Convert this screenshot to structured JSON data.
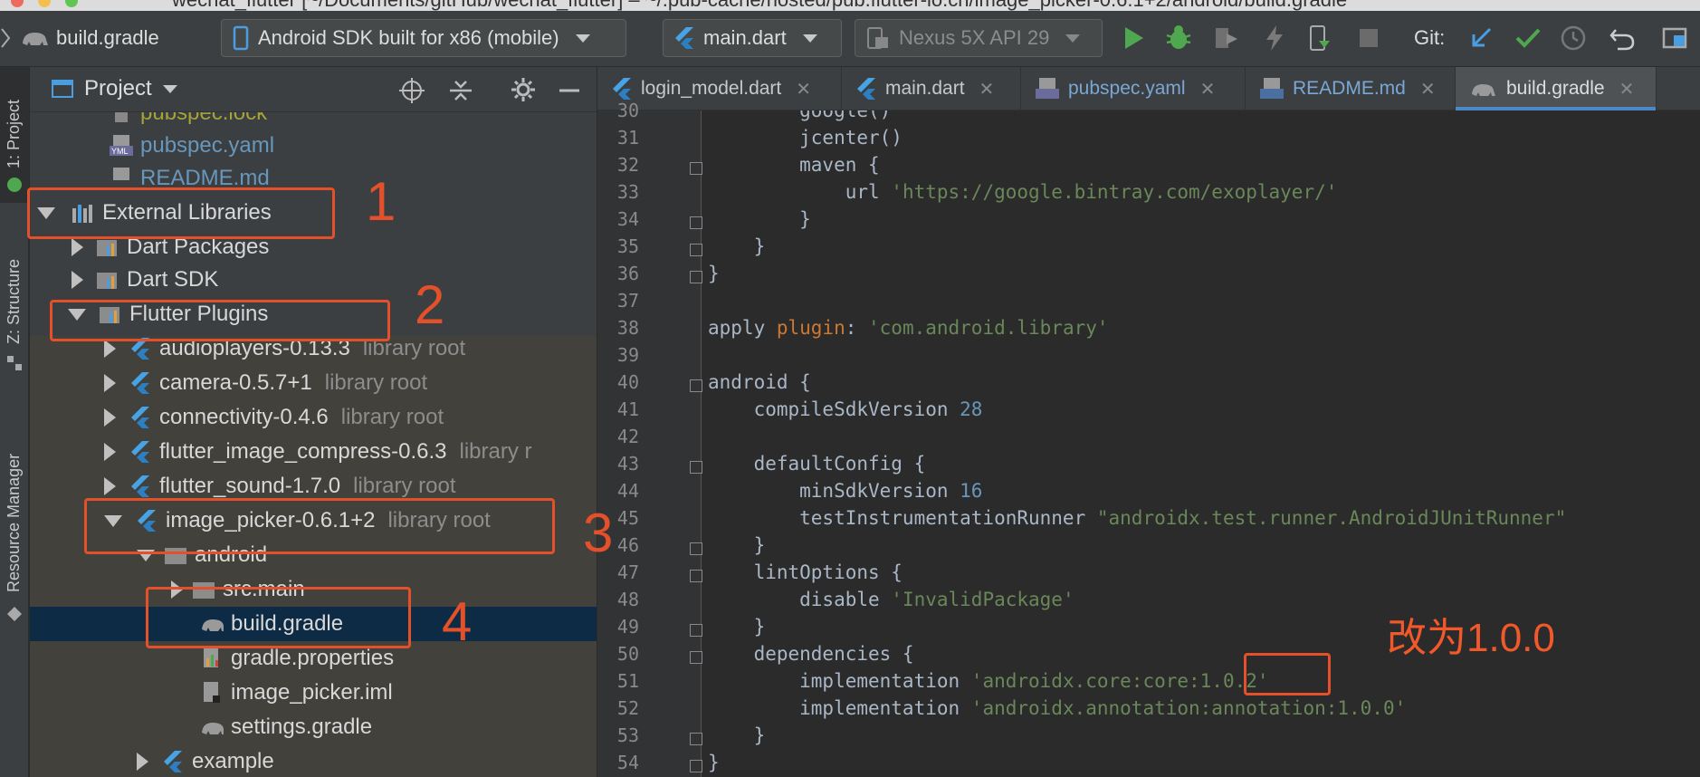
{
  "window": {
    "title_fragment": "wechat_flutter [~/Documents/gitHub/wechat_flutter] – ~/.pub-cache/hosted/pub.flutter-io.cn/image_picker-0.6.1+2/android/build.gradle"
  },
  "toolbar": {
    "breadcrumb_file": "build.gradle",
    "device_combo": "Android SDK built for x86 (mobile)",
    "run_config_combo": "main.dart",
    "emulator_combo": "Nexus 5X API 29",
    "git_label": "Git:"
  },
  "stripe": {
    "project_tab": "1: Project",
    "structure_tab": "Z: Structure",
    "resource_tab": "Resource Manager"
  },
  "project_panel": {
    "title": "Project",
    "rows": [
      {
        "label": "pubspec.lock",
        "extra": ""
      },
      {
        "label": "pubspec.yaml",
        "extra": ""
      },
      {
        "label": "README.md",
        "extra": ""
      },
      {
        "label": "External Libraries",
        "extra": ""
      },
      {
        "label": "Dart Packages",
        "extra": ""
      },
      {
        "label": "Dart SDK",
        "extra": ""
      },
      {
        "label": "Flutter Plugins",
        "extra": ""
      },
      {
        "label": "audioplayers-0.13.3",
        "extra": "library root"
      },
      {
        "label": "camera-0.5.7+1",
        "extra": "library root"
      },
      {
        "label": "connectivity-0.4.6",
        "extra": "library root"
      },
      {
        "label": "flutter_image_compress-0.6.3",
        "extra": "library r"
      },
      {
        "label": "flutter_sound-1.7.0",
        "extra": "library root"
      },
      {
        "label": "image_picker-0.6.1+2",
        "extra": "library root"
      },
      {
        "label": "android",
        "extra": ""
      },
      {
        "label": "src.main",
        "extra": ""
      },
      {
        "label": "build.gradle",
        "extra": ""
      },
      {
        "label": "gradle.properties",
        "extra": ""
      },
      {
        "label": "image_picker.iml",
        "extra": ""
      },
      {
        "label": "settings.gradle",
        "extra": ""
      },
      {
        "label": "example",
        "extra": ""
      }
    ]
  },
  "tabs": [
    {
      "label": "login_model.dart"
    },
    {
      "label": "main.dart"
    },
    {
      "label": "pubspec.yaml"
    },
    {
      "label": "README.md"
    },
    {
      "label": "build.gradle"
    }
  ],
  "editor": {
    "lines": [
      {
        "n": "30",
        "text": "        google()"
      },
      {
        "n": "31",
        "text": "        jcenter()"
      },
      {
        "n": "32",
        "text": "        maven {"
      },
      {
        "n": "33",
        "text": "            url 'https://google.bintray.com/exoplayer/'"
      },
      {
        "n": "34",
        "text": "        }"
      },
      {
        "n": "35",
        "text": "    }"
      },
      {
        "n": "36",
        "text": "}"
      },
      {
        "n": "37",
        "text": ""
      },
      {
        "n": "38",
        "text": "apply plugin: 'com.android.library'"
      },
      {
        "n": "39",
        "text": ""
      },
      {
        "n": "40",
        "text": "android {"
      },
      {
        "n": "41",
        "text": "    compileSdkVersion 28"
      },
      {
        "n": "42",
        "text": ""
      },
      {
        "n": "43",
        "text": "    defaultConfig {"
      },
      {
        "n": "44",
        "text": "        minSdkVersion 16"
      },
      {
        "n": "45",
        "text": "        testInstrumentationRunner \"androidx.test.runner.AndroidJUnitRunner\""
      },
      {
        "n": "46",
        "text": "    }"
      },
      {
        "n": "47",
        "text": "    lintOptions {"
      },
      {
        "n": "48",
        "text": "        disable 'InvalidPackage'"
      },
      {
        "n": "49",
        "text": "    }"
      },
      {
        "n": "50",
        "text": "    dependencies {"
      },
      {
        "n": "51",
        "text": "        implementation 'androidx.core:core:1.0.2'"
      },
      {
        "n": "52",
        "text": "        implementation 'androidx.annotation:annotation:1.0.0'"
      },
      {
        "n": "53",
        "text": "    }"
      },
      {
        "n": "54",
        "text": "}"
      }
    ],
    "annotation": "改为1.0.0"
  },
  "callouts": [
    "1",
    "2",
    "3",
    "4"
  ],
  "colors": {
    "annotation_red": "#e4502a",
    "selection": "#0e2b46",
    "accent_blue": "#4a88c7"
  }
}
